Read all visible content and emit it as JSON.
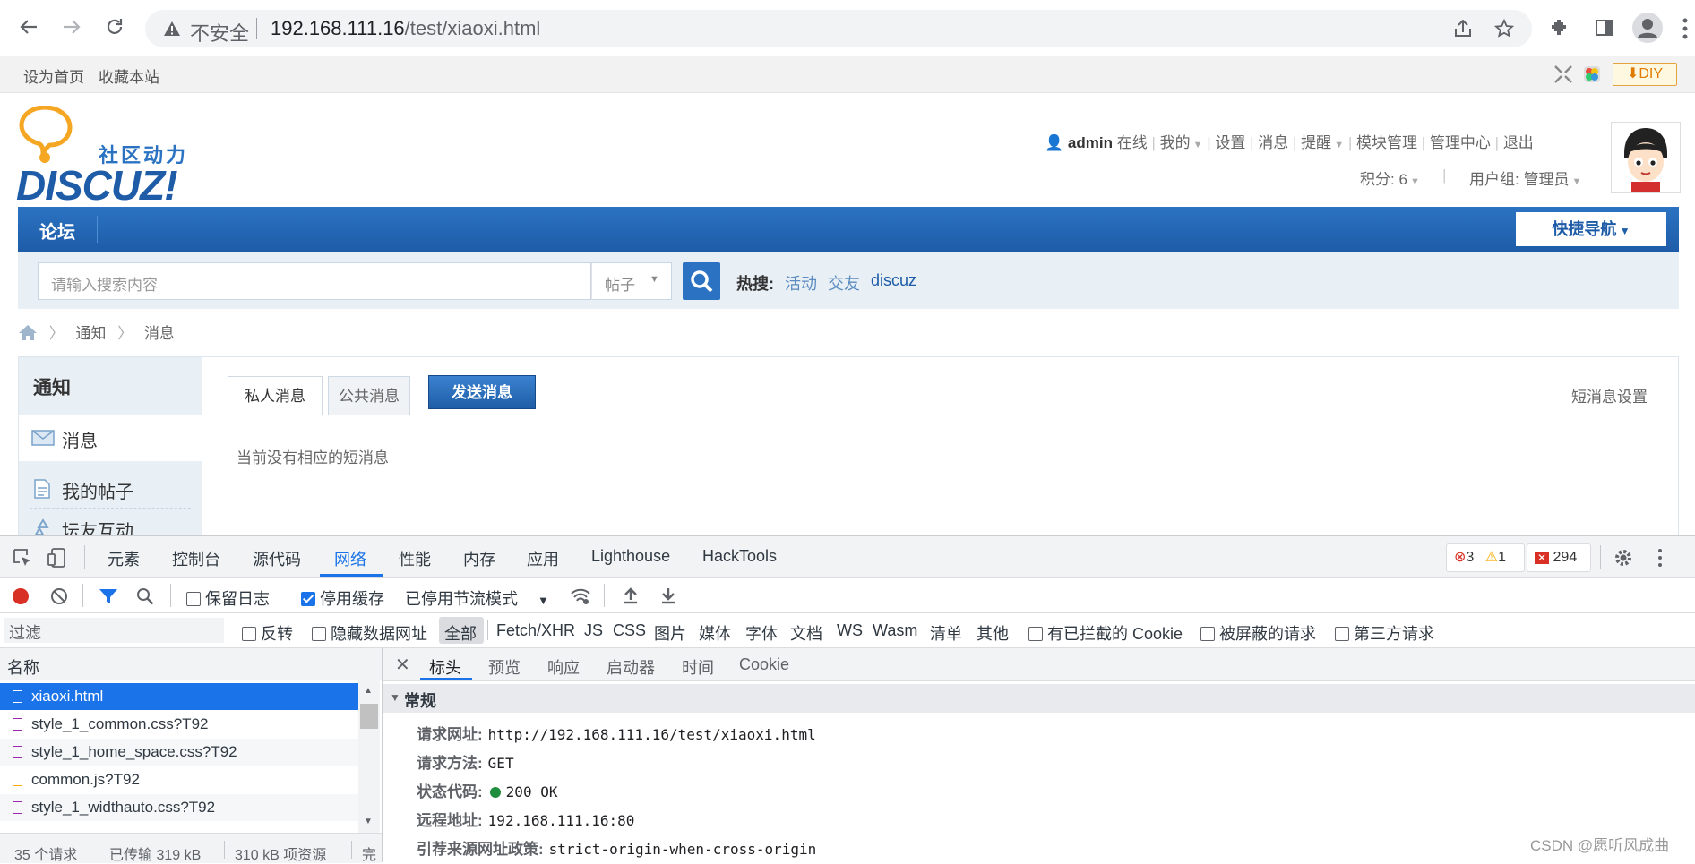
{
  "browser": {
    "insecure_label": "不安全",
    "url_host": "192.168.111.16",
    "url_path": "/test/xiaoxi.html"
  },
  "topbar": {
    "set_home": "设为首页",
    "bookmark": "收藏本站",
    "diy": "DIY"
  },
  "logo": {
    "tagline": "社区动力",
    "brand": "DISCUZ!"
  },
  "user_menu": {
    "username": "admin",
    "online": "在线",
    "items": [
      "我的",
      "设置",
      "消息",
      "提醒",
      "模块管理",
      "管理中心",
      "退出"
    ],
    "credits_label": "积分: 6",
    "group_label": "用户组: 管理员"
  },
  "nav": {
    "forum": "论坛",
    "quick_nav": "快捷导航"
  },
  "search": {
    "placeholder": "请输入搜索内容",
    "type": "帖子",
    "hot_label": "热搜:",
    "hot_terms": [
      "活动",
      "交友",
      "discuz"
    ]
  },
  "breadcrumb": [
    "通知",
    "消息"
  ],
  "sidebar": {
    "title": "通知",
    "items": [
      "消息",
      "我的帖子",
      "坛友互动"
    ]
  },
  "main": {
    "tabs": [
      "私人消息",
      "公共消息"
    ],
    "send_button": "发送消息",
    "settings_link": "短消息设置",
    "empty_text": "当前没有相应的短消息"
  },
  "devtools": {
    "tabs": [
      "元素",
      "控制台",
      "源代码",
      "网络",
      "性能",
      "内存",
      "应用",
      "Lighthouse",
      "HackTools"
    ],
    "selected_tab": "网络",
    "errors": "3",
    "warnings": "1",
    "issues": "294",
    "preserve_log": "保留日志",
    "disable_cache": "停用缓存",
    "throttle": "已停用节流模式",
    "filter_placeholder": "过滤",
    "invert": "反转",
    "hide_data_urls": "隐藏数据网址",
    "types": [
      "全部",
      "Fetch/XHR",
      "JS",
      "CSS",
      "图片",
      "媒体",
      "字体",
      "文档",
      "WS",
      "Wasm",
      "清单",
      "其他"
    ],
    "blocked_cookies": "有已拦截的 Cookie",
    "blocked_requests": "被屏蔽的请求",
    "third_party": "第三方请求",
    "name_header": "名称",
    "requests": [
      {
        "name": "xiaoxi.html",
        "kind": "doc"
      },
      {
        "name": "style_1_common.css?T92",
        "kind": "css"
      },
      {
        "name": "style_1_home_space.css?T92",
        "kind": "css"
      },
      {
        "name": "common.js?T92",
        "kind": "js"
      },
      {
        "name": "style_1_widthauto.css?T92",
        "kind": "css"
      }
    ],
    "status_bar": {
      "requests": "35 个请求",
      "transferred": "已传输 319 kB",
      "resources": "310 kB 项资源",
      "finish": "完"
    },
    "detail_tabs": [
      "标头",
      "预览",
      "响应",
      "启动器",
      "时间",
      "Cookie"
    ],
    "section": "常规",
    "general": [
      {
        "key": "请求网址:",
        "value": "http://192.168.111.16/test/xiaoxi.html"
      },
      {
        "key": "请求方法:",
        "value": "GET"
      },
      {
        "key": "状态代码:",
        "value": "200 OK"
      },
      {
        "key": "远程地址:",
        "value": "192.168.111.16:80"
      },
      {
        "key": "引荐来源网址政策:",
        "value": "strict-origin-when-cross-origin"
      }
    ]
  },
  "watermark": "CSDN @愿听风成曲"
}
